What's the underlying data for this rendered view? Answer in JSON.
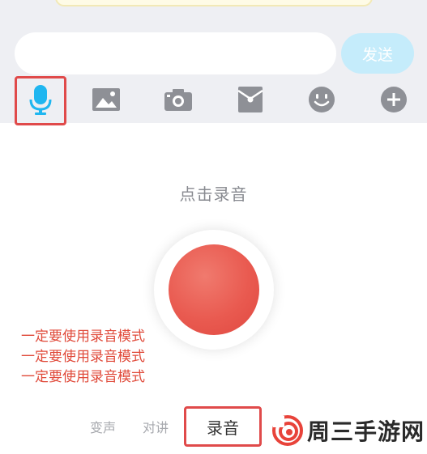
{
  "composer": {
    "input_value": "",
    "send_label": "发送"
  },
  "toolbar": {
    "icons": [
      "microphone-icon",
      "image-icon",
      "camera-icon",
      "red-packet-icon",
      "emoji-icon",
      "plus-icon"
    ],
    "active": "microphone-icon"
  },
  "recorder": {
    "hint": "点击录音",
    "notes": [
      "一定要使用录音模式",
      "一定要使用录音模式",
      "一定要使用录音模式"
    ]
  },
  "modes": {
    "items": [
      "变声",
      "对讲",
      "录音"
    ],
    "active": "录音"
  },
  "watermark": {
    "text": "周三手游网"
  },
  "colors": {
    "accent": "#1fb6f0",
    "send_bg": "#c5ecfb",
    "record": "#e95a50",
    "annotation": "#e04a4a",
    "icon_gray": "#8e9096"
  }
}
